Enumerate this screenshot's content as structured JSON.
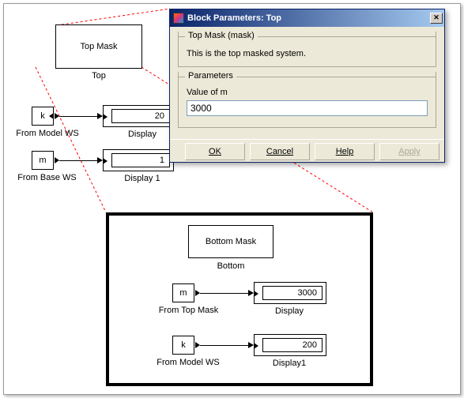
{
  "dialog": {
    "title": "Block Parameters: Top",
    "group_mask_legend": "Top Mask (mask)",
    "description": "This is the top masked system.",
    "group_params_legend": "Parameters",
    "param_label": "Value of m",
    "param_value": "3000",
    "buttons": {
      "ok": "OK",
      "cancel": "Cancel",
      "help": "Help",
      "apply": "Apply"
    },
    "close": "✕"
  },
  "top_level": {
    "top_mask": {
      "inside": "Top Mask",
      "label": "Top"
    },
    "from_model_ws": {
      "inside": "k",
      "label": "From Model WS"
    },
    "from_base_ws": {
      "inside": "m",
      "label": "From Base WS"
    },
    "display": {
      "value": "20",
      "label": "Display"
    },
    "display1": {
      "value": "1",
      "label": "Display 1"
    }
  },
  "detail": {
    "bottom_mask": {
      "inside": "Bottom Mask",
      "label": "Bottom"
    },
    "from_top_mask": {
      "inside": "m",
      "label": "From Top Mask"
    },
    "from_model_ws": {
      "inside": "k",
      "label": "From Model WS"
    },
    "display": {
      "value": "3000",
      "label": "Display"
    },
    "display1": {
      "value": "200",
      "label": "Display1"
    }
  }
}
